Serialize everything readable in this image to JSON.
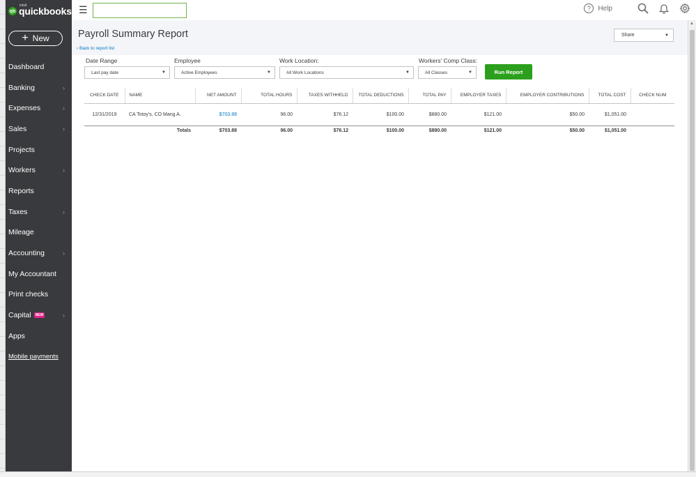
{
  "app": {
    "logo_small": "intuit",
    "logo_text": "quickbooks",
    "logo_mark": "qb"
  },
  "sidebar": {
    "new_label": "New",
    "items": [
      {
        "label": "Dashboard",
        "chevron": false
      },
      {
        "label": "Banking",
        "chevron": true
      },
      {
        "label": "Expenses",
        "chevron": true
      },
      {
        "label": "Sales",
        "chevron": true
      },
      {
        "label": "Projects",
        "chevron": false
      },
      {
        "label": "Workers",
        "chevron": true
      },
      {
        "label": "Reports",
        "chevron": false
      },
      {
        "label": "Taxes",
        "chevron": true
      },
      {
        "label": "Mileage",
        "chevron": false
      },
      {
        "label": "Accounting",
        "chevron": true
      },
      {
        "label": "My Accountant",
        "chevron": false
      },
      {
        "label": "Print checks",
        "chevron": false
      },
      {
        "label": "Capital",
        "chevron": true,
        "badge": "NEW"
      },
      {
        "label": "Apps",
        "chevron": false
      },
      {
        "label": "Mobile payments",
        "chevron": false
      }
    ]
  },
  "topbar": {
    "search_value": "",
    "help_label": "Help"
  },
  "report": {
    "title": "Payroll Summary Report",
    "back_link": "Back to report list",
    "share_label": "Share"
  },
  "filters": {
    "date_range": {
      "label": "Date Range",
      "value": "Last pay date"
    },
    "employee": {
      "label": "Employee",
      "value": "Active Employees"
    },
    "work_location": {
      "label": "Work Location:",
      "value": "All Work Locations"
    },
    "workers_comp": {
      "label": "Workers' Comp Class:",
      "value": "All Classes"
    },
    "run_label": "Run Report"
  },
  "table": {
    "headers": {
      "check_date": "CHECK DATE",
      "name": "NAME",
      "net_amount": "NET AMOUNT",
      "total_hours": "TOTAL HOURS",
      "taxes_withheld": "TAXES WITHHELD",
      "total_deductions": "TOTAL DEDUCTIONS",
      "total_pay": "TOTAL PAY",
      "employer_taxes": "EMPLOYER TAXES",
      "employer_contributions": "EMPLOYER CONTRIBUTIONS",
      "total_cost": "TOTAL COST",
      "check_num": "CHECK NUM"
    },
    "row": {
      "check_date": "12/31/2019",
      "name": "CA Totoy's, CO Mang A.",
      "net_amount": "$703.88",
      "total_hours": "96.00",
      "taxes_withheld": "$76.12",
      "total_deductions": "$100.00",
      "total_pay": "$880.00",
      "employer_taxes": "$121.00",
      "employer_contributions": "$50.00",
      "total_cost": "$1,051.00",
      "check_num": ""
    },
    "totals": {
      "label": "Totals",
      "net_amount": "$703.88",
      "total_hours": "96.00",
      "taxes_withheld": "$76.12",
      "total_deductions": "$100.00",
      "total_pay": "$880.00",
      "employer_taxes": "$121.00",
      "employer_contributions": "$50.00",
      "total_cost": "$1,051.00"
    }
  },
  "colors": {
    "sidebar_bg": "#393a3d",
    "accent_green": "#2ca01c",
    "link_blue": "#0077c5",
    "badge_pink": "#e0218a"
  }
}
